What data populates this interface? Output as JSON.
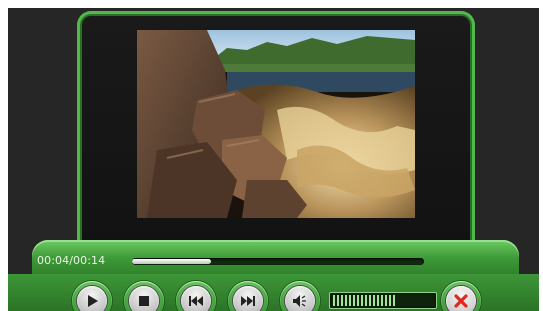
{
  "player": {
    "time_display": "00:04/00:14",
    "progress_fraction": 0.27,
    "volume_fraction": 0.62
  },
  "controls": {
    "play_icon": "play-icon",
    "stop_icon": "stop-icon",
    "previous_icon": "previous-icon",
    "next_icon": "next-icon",
    "mute_icon": "speaker-icon",
    "close_icon": "close-icon"
  },
  "colors": {
    "accent_green": "#4aa844",
    "close_red": "#e0281e",
    "background": "#262626"
  }
}
